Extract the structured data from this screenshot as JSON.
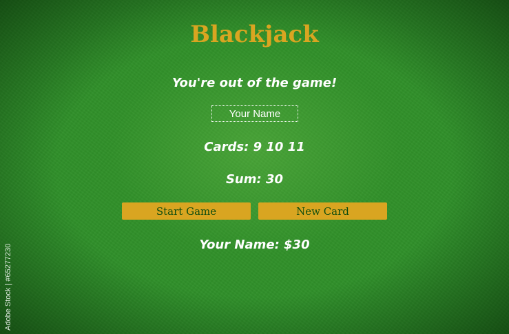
{
  "header": {
    "title": "Blackjack"
  },
  "game": {
    "message": "You're out of the game!",
    "name_input_placeholder": "Your Name",
    "cards_label": "Cards: 9 10 11",
    "sum_label": "Sum: 30",
    "player_label": "Your Name: $30"
  },
  "buttons": {
    "start_label": "Start Game",
    "new_card_label": "New Card"
  },
  "watermark": {
    "text": "Adobe Stock | #65277230"
  },
  "colors": {
    "accent": "#d9a521",
    "felt": "#2f8f2a",
    "text": "#ffffff",
    "button_text": "#0f4d0f"
  }
}
